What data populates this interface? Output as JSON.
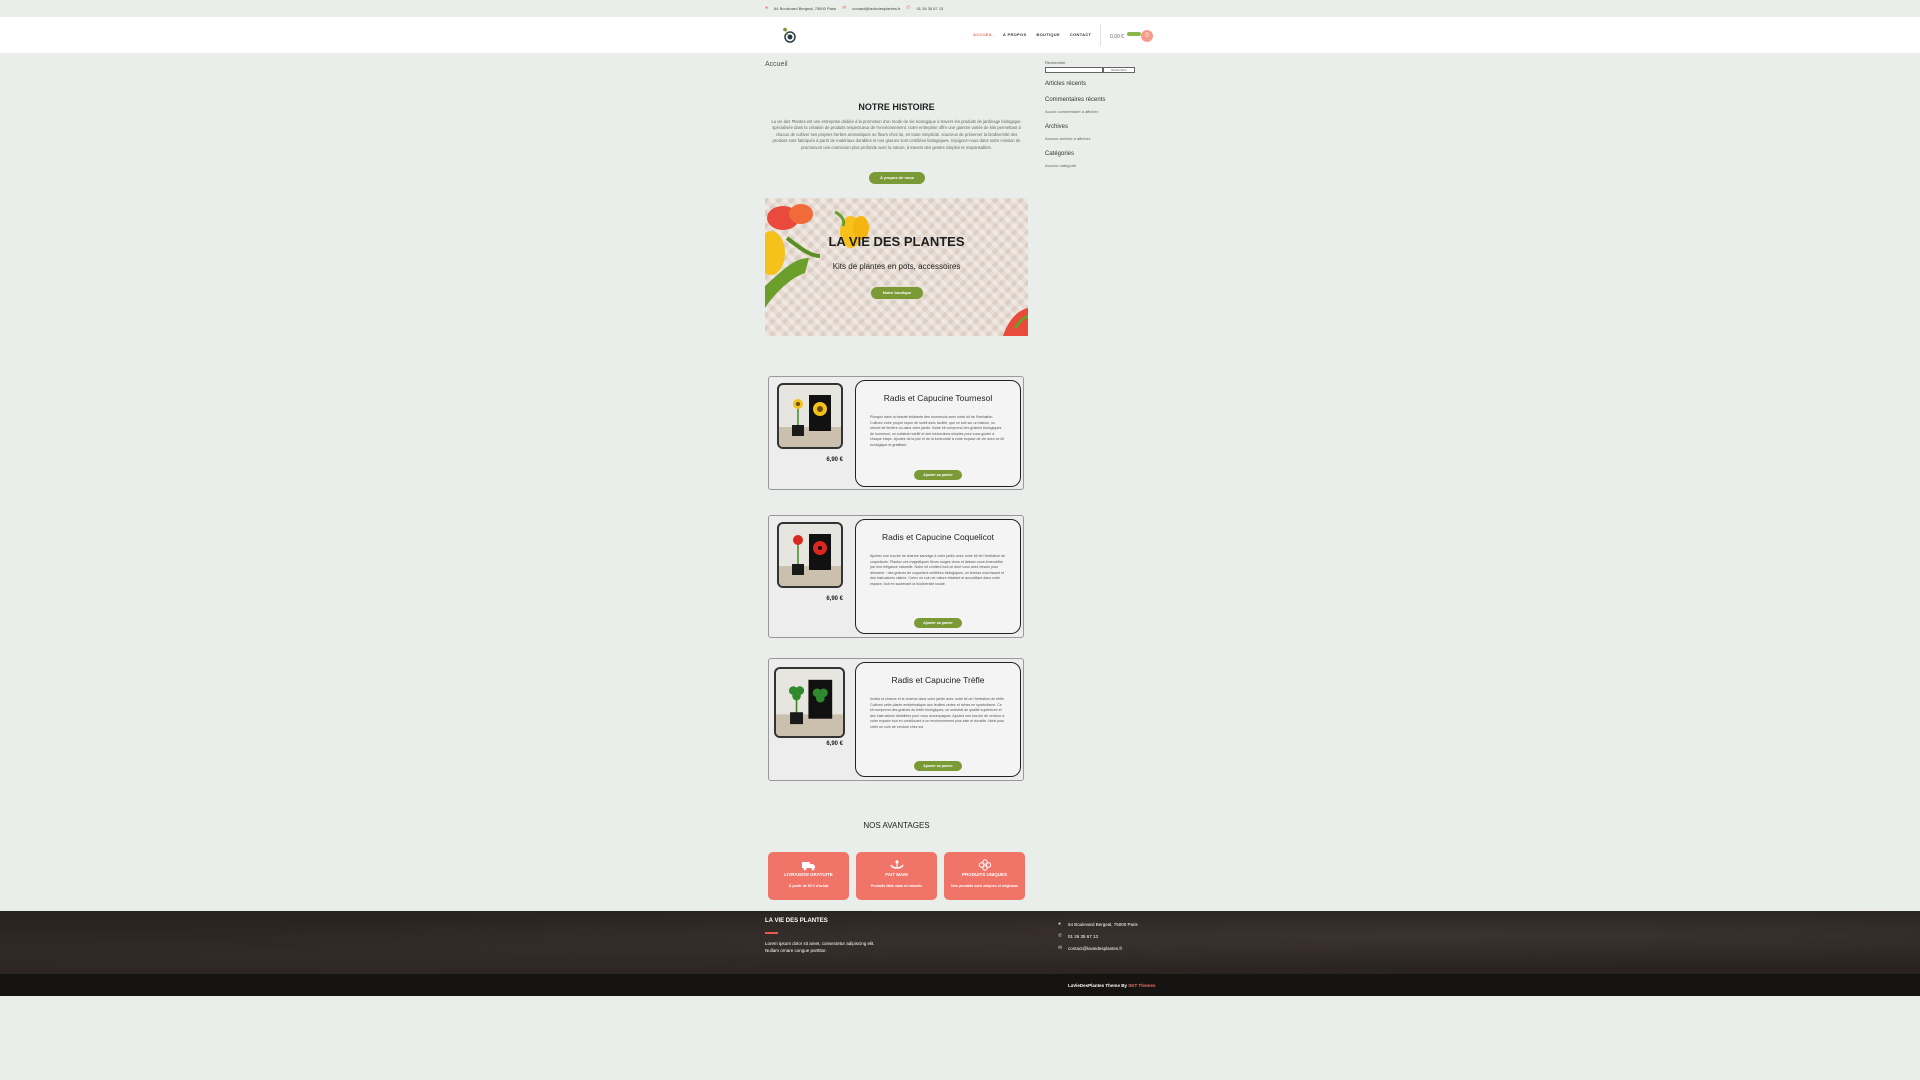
{
  "topbar": {
    "address": "64 Boulevard Bergeal, 75000 Paris",
    "email": "contact@laviedesplantes.fr",
    "phone": "01 26 35 67 13"
  },
  "nav": {
    "items": [
      {
        "label": "ACCUEIL",
        "active": true
      },
      {
        "label": "À PROPOS",
        "active": false
      },
      {
        "label": "BOUTIQUE",
        "active": false
      },
      {
        "label": "CONTACT",
        "active": false
      }
    ],
    "cart_total": "0,00 €",
    "cart_count": "0"
  },
  "breadcrumb": "Accueil",
  "sidebar": {
    "search_label": "Rechercher",
    "search_button": "Rechercher",
    "recent_posts_title": "Articles récents",
    "recent_comments_title": "Commentaires récents",
    "recent_comments_empty": "Aucun commentaire à afficher.",
    "archives_title": "Archives",
    "archives_empty": "Aucune archive à afficher.",
    "categories_title": "Catégories",
    "categories_empty": "Aucune catégorie"
  },
  "history": {
    "title": "NOTRE HISTOIRE",
    "text": "La vie des Plantes est une entreprise dédiée à la promotion d'un mode de vie écologique à travers les produits de jardinage biologique. spécialisée dans la création de produits respectueux de l'environnement. notre entreprise offre une gamme variée de kits permettant à chacun de cultiver ses propres herbes aromatiques ou fleurs chez lui, en toute simplicité. soucieux de préserver la biodiversité des produits sont fabriqués à partir de matériaux durables et nos graines sont certifiées biologiques. rejoignez-nous dans notre mission de promouvoir une connexion plus profonde avec la nature, à travers des gestes simples et responsables.",
    "button": "À propos de nous"
  },
  "hero": {
    "title": "LA VIE DES PLANTES",
    "subtitle": "Kits de plantes en pots, accessoires",
    "button": "Notre boutique"
  },
  "products": [
    {
      "name": "Radis et Capucine Tournesol",
      "price": "6,90 €",
      "description": "Plongez dans la beauté éclatante des tournesols avec notre kit de l'herbation. Cultivez votre propre rayon de soleil avec facilité, que ce soit sur un balcon, un rebord de fenêtre ou dans votre jardin. Notre kit comprend des graines biologiques de tournesol, un substrat nutritif et des instructions simples pour vous guider à chaque étape. Ajoutez de la joie et de la luminosité à votre espace de vie avec ce kit écologique et gratifiant.",
      "button": "Ajouter au panier",
      "flower_color": "#f2c21b"
    },
    {
      "name": "Radis et Capucine Coquelicot",
      "price": "6,90 €",
      "description": "Ajoutez une touche de charme sauvage à votre jardin avec notre kit de l'herbation de coquelicots. Plantez ces magnifiques fleurs rouges vives et laissez-vous émerveiller par leur élégance naturelle. Notre kit contient tout ce dont vous avez besoin pour démarrer : des graines de coquelicot certifiées biologiques, un terreau nourrissant et des instructions claires. Créez un coin de nature éclatant et accueillant dans votre espace, tout en soutenant la biodiversité locale.",
      "button": "Ajouter au panier",
      "flower_color": "#d8281f"
    },
    {
      "name": "Radis et Capucine Trèfle",
      "price": "6,90 €",
      "description": "Invitez la chance et le charme dans votre jardin avec notre kit de l'herbation de trèfle. Cultivez cette plante emblématique aux feuilles vertes et riches en symbolisme. Ce kit comprend des graines de trèfle biologiques, un substrat de qualité supérieure et des instructions détaillées pour vous accompagner. Ajoutez une touche de verdure à votre espace tout en contribuant à un environnement plus sain et durable. Idéal pour créer un coin de verdure chez soi.",
      "button": "Ajouter au panier",
      "flower_color": "#2e8a2c"
    }
  ],
  "advantages": {
    "title": "NOS AVANTAGES",
    "items": [
      {
        "icon": "truck-icon",
        "title": "LIVRAISON GRATUITE",
        "text": "À partir de 50 € d'achat"
      },
      {
        "icon": "hands-plant-icon",
        "title": "FAIT MAIN",
        "text": "Produits faits main et naturels"
      },
      {
        "icon": "flower-icon",
        "title": "PRODUITS UNIQUES",
        "text": "Nos produits sont uniques et originaux"
      }
    ]
  },
  "footer": {
    "title": "LA VIE DES PLANTES",
    "text": "Lorem ipsum dolor sit amet, consectetur adipiscing elit. Nullam ornare congue porttitor.",
    "address": "64 Boulevard Bergeal, 75000 Paris",
    "phone": "01 26 35 67 13",
    "email": "contact@laviedesplantes.fr",
    "credit_prefix": "LaVieDesPlantes Theme By ",
    "credit_link": "SKT Themes"
  },
  "colors": {
    "accent": "#f26e5f",
    "green": "#7a9a35",
    "advantage_bg": "#f07468",
    "footer_bg": "#2a2320"
  }
}
